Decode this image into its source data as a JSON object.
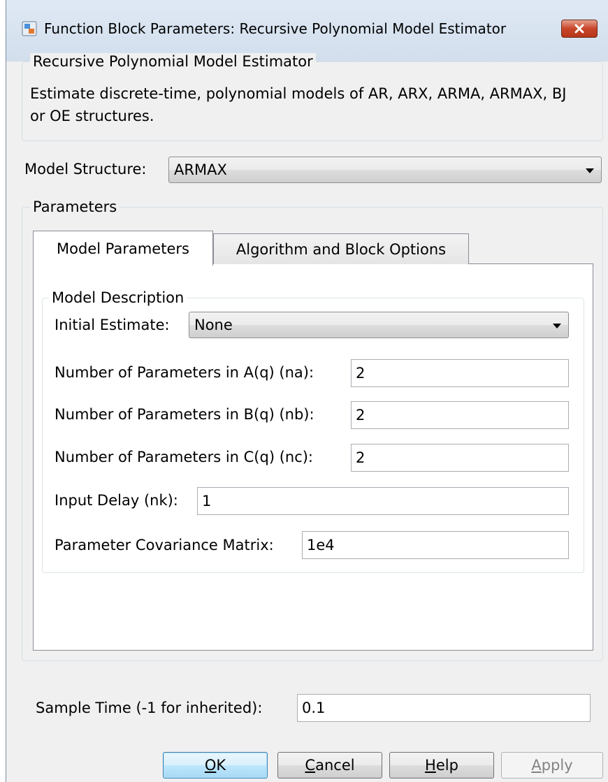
{
  "window": {
    "title": "Function Block Parameters: Recursive Polynomial Model Estimator"
  },
  "block": {
    "group_title": "Recursive Polynomial Model Estimator",
    "description": "Estimate discrete-time, polynomial models of AR, ARX, ARMA, ARMAX, BJ or OE structures."
  },
  "model_structure": {
    "label": "Model Structure:",
    "value": "ARMAX"
  },
  "parameters": {
    "group_title": "Parameters",
    "tabs": [
      {
        "label": "Model Parameters",
        "active": true
      },
      {
        "label": "Algorithm and Block Options",
        "active": false
      }
    ],
    "model_description": {
      "group_title": "Model Description",
      "initial_estimate": {
        "label": "Initial Estimate:",
        "value": "None"
      },
      "fields": [
        {
          "label": "Number of Parameters in A(q) (na):",
          "value": "2"
        },
        {
          "label": "Number of Parameters in B(q) (nb):",
          "value": "2"
        },
        {
          "label": "Number of Parameters in C(q) (nc):",
          "value": "2"
        },
        {
          "label": "Input Delay (nk):",
          "value": "1"
        },
        {
          "label": "Parameter Covariance Matrix:",
          "value": "1e4"
        }
      ]
    }
  },
  "sample_time": {
    "label": "Sample Time (-1 for inherited):",
    "value": "0.1"
  },
  "buttons": {
    "ok": {
      "mnemonic": "O",
      "rest": "K"
    },
    "cancel": {
      "mnemonic": "C",
      "rest": "ancel"
    },
    "help": {
      "mnemonic": "H",
      "rest": "elp"
    },
    "apply": {
      "mnemonic": "A",
      "rest": "pply",
      "disabled": true
    }
  },
  "icons": {
    "title_icon": "simulink-block-icon",
    "close_icon": "close-x-icon",
    "dropdown_icon": "chevron-down-icon"
  },
  "colors": {
    "close_button": "#c8452b",
    "default_button_border": "#3c7fb1"
  }
}
